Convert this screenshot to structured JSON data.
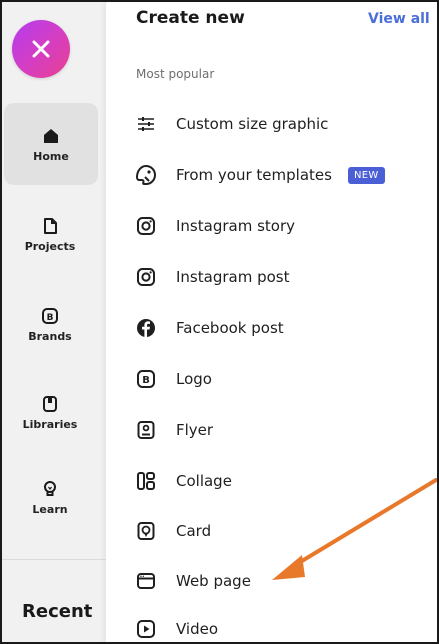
{
  "rail": {
    "close_icon": "close-icon",
    "items": [
      {
        "label": "Home",
        "icon": "home-icon",
        "active": true
      },
      {
        "label": "Projects",
        "icon": "projects-icon"
      },
      {
        "label": "Brands",
        "icon": "brands-icon"
      },
      {
        "label": "Libraries",
        "icon": "libraries-icon"
      },
      {
        "label": "Learn",
        "icon": "learn-icon"
      }
    ],
    "recent_label": "Recent"
  },
  "panel": {
    "title": "Create new",
    "view_all": "View all",
    "section_label": "Most popular",
    "items": [
      {
        "label": "Custom size graphic",
        "icon": "sliders-icon"
      },
      {
        "label": "From your templates",
        "icon": "templates-icon",
        "badge": "NEW"
      },
      {
        "label": "Instagram story",
        "icon": "instagram-icon"
      },
      {
        "label": "Instagram post",
        "icon": "instagram-icon"
      },
      {
        "label": "Facebook post",
        "icon": "facebook-icon"
      },
      {
        "label": "Logo",
        "icon": "logo-icon"
      },
      {
        "label": "Flyer",
        "icon": "flyer-icon"
      },
      {
        "label": "Collage",
        "icon": "collage-icon"
      },
      {
        "label": "Card",
        "icon": "card-icon"
      },
      {
        "label": "Web page",
        "icon": "web-page-icon"
      },
      {
        "label": "Video",
        "icon": "video-icon"
      }
    ]
  },
  "colors": {
    "accent_link": "#4a6fd8",
    "badge": "#4a5fd6",
    "annotation_arrow": "#e8782a",
    "close_gradient_start": "#b53cf0",
    "close_gradient_end": "#e8408e"
  }
}
